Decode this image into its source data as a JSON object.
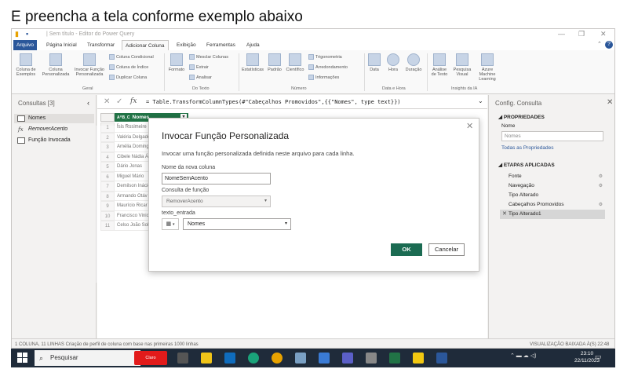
{
  "caption": "E preencha a tela conforme exemplo abaixo",
  "window": {
    "title": "| Sem título - Editor do Power Query",
    "help_icon": "?"
  },
  "menu": [
    "Arquivo",
    "Página Inicial",
    "Transformar",
    "Adicionar Coluna",
    "Exibição",
    "Ferramentas",
    "Ajuda"
  ],
  "ribbon": {
    "col_exemplos": "Coluna de\nExemplos",
    "col_personalizada": "Coluna\nPersonalizada",
    "invocar_funcao": "Invocar Função\nPersonalizada",
    "coluna_condicional": "Coluna Condicional",
    "coluna_indice": "Coluna de Índice",
    "duplicar_coluna": "Duplicar Coluna",
    "group_geral": "Geral",
    "formato": "Formato",
    "mesclar_colunas": "Mesclar Colunas",
    "extrair": "Extrair",
    "analisar": "Analisar",
    "group_texto": "Do Texto",
    "estatisticas": "Estatísticas",
    "padrao": "Padrão",
    "cientifico": "Científico",
    "trigonometria": "Trigonometria",
    "arredondamento": "Arredondamento",
    "informacoes": "Informações",
    "group_numero": "Número",
    "data": "Data",
    "hora": "Hora",
    "duracao": "Duração",
    "group_datahora": "Data e Hora",
    "analise_texto": "Análise\nde Texto",
    "pesquisa_visual": "Pesquisa\nVisual",
    "azure_ml": "Azure Machine\nLearning",
    "group_ia": "Insights da IA"
  },
  "queries": {
    "title": "Consultas [3]",
    "items": [
      "Nomes",
      "RemoverAcento",
      "Função Invocada"
    ]
  },
  "formula": "= Table.TransformColumnTypes(#\"Cabeçalhos Promovidos\",{{\"Nomes\", type text}})",
  "grid": {
    "column": "Nomes",
    "type_icon": "A^B_C",
    "rows": [
      "Ísis Rosimeire",
      "Valéria Delgado",
      "Amélia Doming",
      "Cibele Nádia Á",
      "Dário Jonas",
      "Miguel Mário",
      "Demilson Inácio",
      "Armando Otáv",
      "Maurício Ricar",
      "Francisco Vinic",
      "Celso João Sola"
    ]
  },
  "settings": {
    "title": "Config. Consulta",
    "props_header": "PROPRIEDADES",
    "name_label": "Nome",
    "name_value": "Nomes",
    "all_props": "Todas as Propriedades",
    "steps_header": "ETAPAS APLICADAS",
    "steps": [
      "Fonte",
      "Navegação",
      "Tipo Alterado",
      "Cabeçalhos Promovidos",
      "Tipo Alterado1"
    ]
  },
  "status": {
    "left": "1 COLUNA, 11 LINHAS   Criação de perfil de coluna com base nas primeiras 1000 linhas",
    "right": "VISUALIZAÇÃO BAIXADA À(S) 22:48"
  },
  "dialog": {
    "title": "Invocar Função Personalizada",
    "description": "Invocar uma função personalizada definida neste arquivo para cada linha.",
    "new_col_label": "Nome da nova coluna",
    "new_col_value": "NomeSemAcento",
    "func_label": "Consulta de função",
    "func_value": "RemoverAcento",
    "param_label": "texto_entrada",
    "param_value": "Nomes",
    "ok": "OK",
    "cancel": "Cancelar"
  },
  "taskbar": {
    "search": "Pesquisar",
    "claro": "Claro",
    "time": "23:10",
    "date": "22/11/2023"
  }
}
